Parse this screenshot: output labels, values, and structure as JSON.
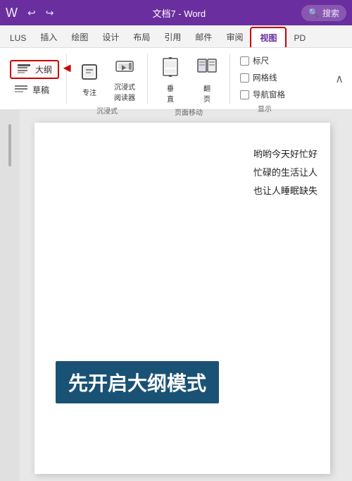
{
  "titleBar": {
    "undoIcon": "↩",
    "redoIcon": "↪",
    "title": "文档7 - Word",
    "searchPlaceholder": "搜索",
    "searchIcon": "🔍"
  },
  "ribbonTabs": {
    "tabs": [
      {
        "label": "LUS",
        "active": false,
        "highlighted": false
      },
      {
        "label": "插入",
        "active": false,
        "highlighted": false
      },
      {
        "label": "绘图",
        "active": false,
        "highlighted": false
      },
      {
        "label": "设计",
        "active": false,
        "highlighted": false
      },
      {
        "label": "布局",
        "active": false,
        "highlighted": false
      },
      {
        "label": "引用",
        "active": false,
        "highlighted": false
      },
      {
        "label": "邮件",
        "active": false,
        "highlighted": false
      },
      {
        "label": "审阅",
        "active": false,
        "highlighted": false
      },
      {
        "label": "视图",
        "active": true,
        "highlighted": true
      },
      {
        "label": "PD",
        "active": false,
        "highlighted": false
      }
    ]
  },
  "ribbon": {
    "viewModes": {
      "groupLabel": "",
      "items": [
        {
          "label": "大纲",
          "icon": "▦",
          "selected": true
        },
        {
          "label": "草稿",
          "icon": "≡",
          "selected": false
        }
      ]
    },
    "immersiveGroup": {
      "label": "沉浸式",
      "buttons": [
        {
          "label": "专注",
          "icon": "📄"
        },
        {
          "label": "沉浸式\n阅读器",
          "icon": "🔊"
        }
      ]
    },
    "pageMoveGroup": {
      "label": "页面移动",
      "buttons": [
        {
          "label": "垂\n直",
          "icon": "⇅"
        },
        {
          "label": "翻\n页",
          "icon": "⬜"
        }
      ]
    },
    "displayGroup": {
      "label": "显示",
      "checkboxes": [
        {
          "label": "标尺",
          "checked": false
        },
        {
          "label": "网格线",
          "checked": false
        },
        {
          "label": "导航窗格",
          "checked": false
        }
      ]
    }
  },
  "document": {
    "textLines": [
      "哟哟今天好忙好",
      "忙碌的生活让人",
      "也让人睡眠缺失"
    ],
    "highlightText": "先开启大纲模式"
  },
  "annotations": {
    "redBoxLabel": "大纲按钮框",
    "arrowLabel": "箭头指示"
  }
}
